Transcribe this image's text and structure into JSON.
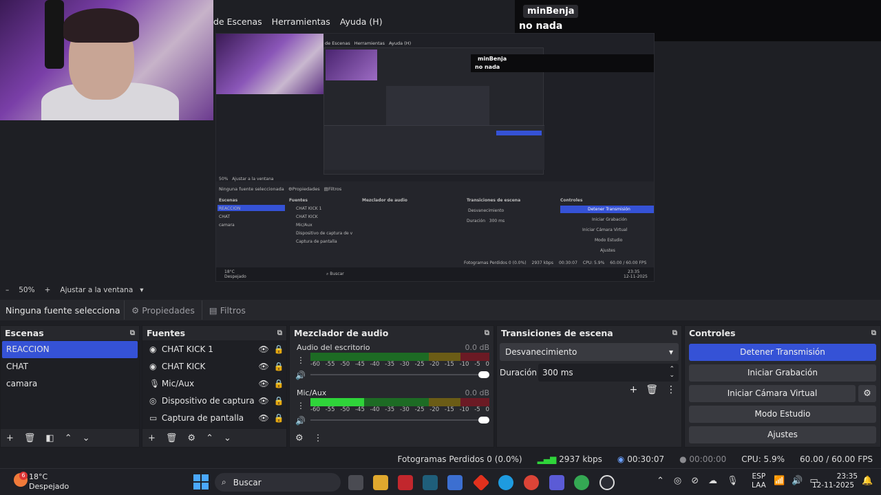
{
  "menu": [
    "de Escenas",
    "Herramientas",
    "Ayuda (H)"
  ],
  "window_controls": [
    "–",
    "❐",
    "✕"
  ],
  "chat": {
    "user": "minBenja",
    "message": "no nada"
  },
  "preview": {
    "nested_user": "minBenja",
    "nested_message": "no nada",
    "nested_menu": [
      "de Escenas",
      "Herramientas",
      "Ayuda (H)"
    ],
    "mini_zoom": "50%",
    "mini_fit": "Ajustar a la ventana",
    "mini_nosrc": "Ninguna fuente seleccionada",
    "mini_props": "Propiedades",
    "mini_filters": "Filtros",
    "mini_scenes": "Escenas",
    "mini_sources": "Fuentes",
    "mini_mixer": "Mezclador de audio",
    "mini_trans": "Transiciones de escena",
    "mini_ctrl": "Controles",
    "mini_scene_items": [
      "REACCION",
      "CHAT",
      "camara"
    ],
    "mini_source_items": [
      "CHAT KICK 1",
      "CHAT KICK",
      "Mic/Aux",
      "Dispositivo de captura de v",
      "Captura de pantalla"
    ],
    "mini_transition": "Desvanecimiento",
    "mini_duration_label": "Duración",
    "mini_duration": "300 ms",
    "mini_buttons": [
      "Detener Transmisión",
      "Iniciar Grabación",
      "Iniciar Cámara Virtual",
      "Modo Estudio",
      "Ajustes"
    ],
    "mini_status": "Fotogramas Perdidos 0 (0.0%)",
    "mini_kbps": "2937 kbps",
    "mini_time": "00:30:07",
    "mini_cpu": "CPU: 5.9%",
    "mini_fps": "60.00 / 60.00 FPS",
    "mini_weather": "18°C",
    "mini_weather_desc": "Despejado",
    "mini_search": "Buscar",
    "mini_clock": "23:35",
    "mini_date": "12-11-2025"
  },
  "zoom": {
    "minus": "–",
    "value": "50%",
    "plus": "+",
    "fit": "Ajustar a la ventana"
  },
  "source_bar": {
    "label": "Ninguna fuente selecciona",
    "properties": "Propiedades",
    "filters": "Filtros"
  },
  "scenes": {
    "title": "Escenas",
    "items": [
      "REACCION",
      "CHAT",
      "camara"
    ],
    "selected": 0
  },
  "sources": {
    "title": "Fuentes",
    "items": [
      {
        "name": "CHAT KICK 1",
        "icon": "browser-icon"
      },
      {
        "name": "CHAT KICK",
        "icon": "browser-icon"
      },
      {
        "name": "Mic/Aux",
        "icon": "mic-icon"
      },
      {
        "name": "Dispositivo de captura de v",
        "icon": "camera-icon"
      },
      {
        "name": "Captura de pantalla",
        "icon": "monitor-icon"
      }
    ]
  },
  "mixer": {
    "title": "Mezclador de audio",
    "channels": [
      {
        "name": "Audio del escritorio",
        "db": "0.0 dB",
        "level": 0
      },
      {
        "name": "Mic/Aux",
        "db": "0.0 dB",
        "level": 0.3
      }
    ],
    "ticks": [
      "-60",
      "-55",
      "-50",
      "-45",
      "-40",
      "-35",
      "-30",
      "-25",
      "-20",
      "-15",
      "-10",
      "-5",
      "0"
    ]
  },
  "transitions": {
    "title": "Transiciones de escena",
    "selected": "Desvanecimiento",
    "duration_label": "Duración",
    "duration": "300 ms"
  },
  "controls": {
    "title": "Controles",
    "buttons": [
      "Detener Transmisión",
      "Iniciar Grabación",
      "Iniciar Cámara Virtual",
      "Modo Estudio",
      "Ajustes"
    ]
  },
  "status": {
    "dropped": "Fotogramas Perdidos 0 (0.0%)",
    "kbps": "2937 kbps",
    "stream_time": "00:30:07",
    "rec_time": "00:00:00",
    "cpu": "CPU: 5.9%",
    "fps": "60.00 / 60.00 FPS"
  },
  "taskbar": {
    "weather_temp": "18°C",
    "weather_desc": "Despejado",
    "weather_badge": "6",
    "search": "Buscar",
    "lang": "ESP",
    "lang2": "LAA",
    "time": "23:35",
    "date": "12-11-2025"
  },
  "colors": {
    "accent": "#3552d6",
    "dock_bg": "#27282d",
    "panel_bg": "#1e1f24"
  }
}
